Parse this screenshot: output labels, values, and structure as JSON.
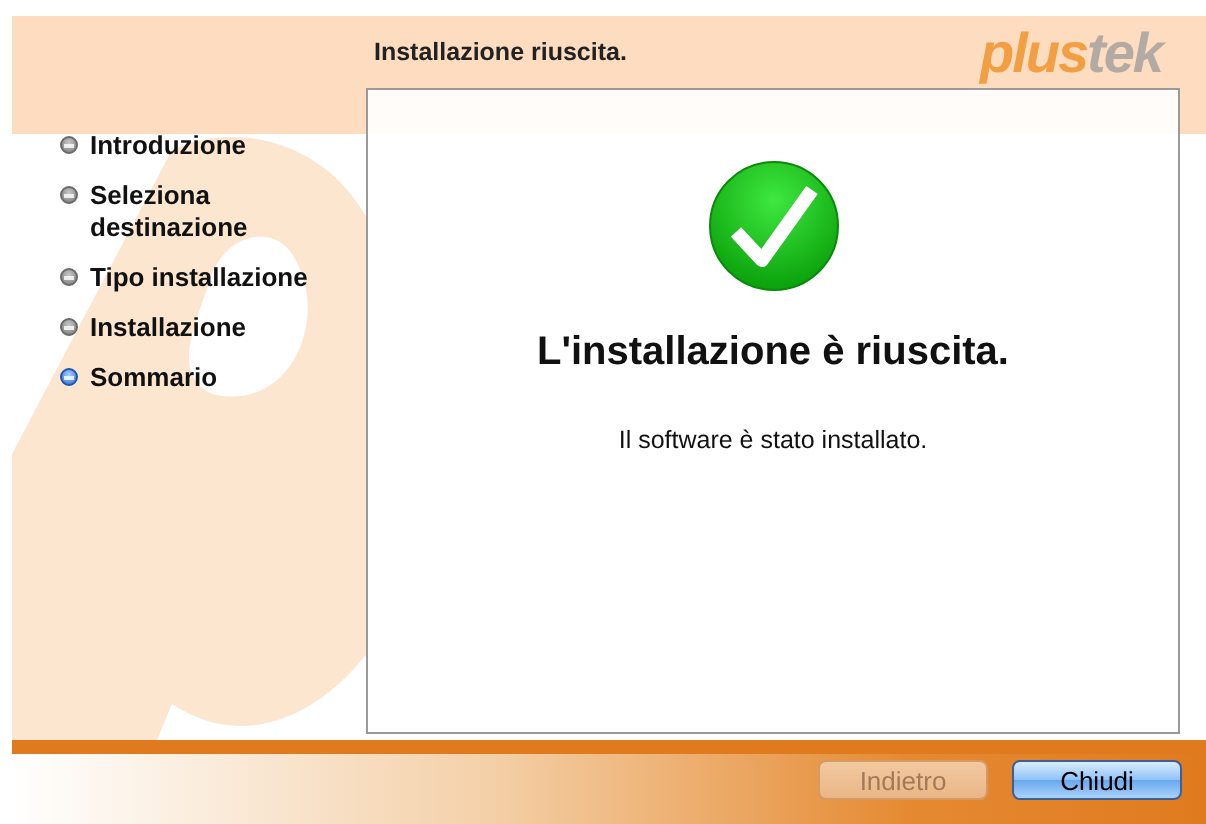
{
  "window": {
    "title": "Installazione riuscita."
  },
  "logo": {
    "part_1": "plus",
    "part_2": "tek"
  },
  "steps": [
    {
      "label": "Introduzione",
      "selected": false
    },
    {
      "label": "Seleziona destinazione",
      "selected": false
    },
    {
      "label": "Tipo installazione",
      "selected": false
    },
    {
      "label": "Installazione",
      "selected": false
    },
    {
      "label": "Sommario",
      "selected": true
    }
  ],
  "content": {
    "heading": "L'installazione è riuscita.",
    "message": "Il software è stato installato."
  },
  "buttons": [
    {
      "label": "Indietro",
      "disabled": true,
      "default": false
    },
    {
      "label": "Chiudi",
      "disabled": false,
      "default": true
    }
  ]
}
